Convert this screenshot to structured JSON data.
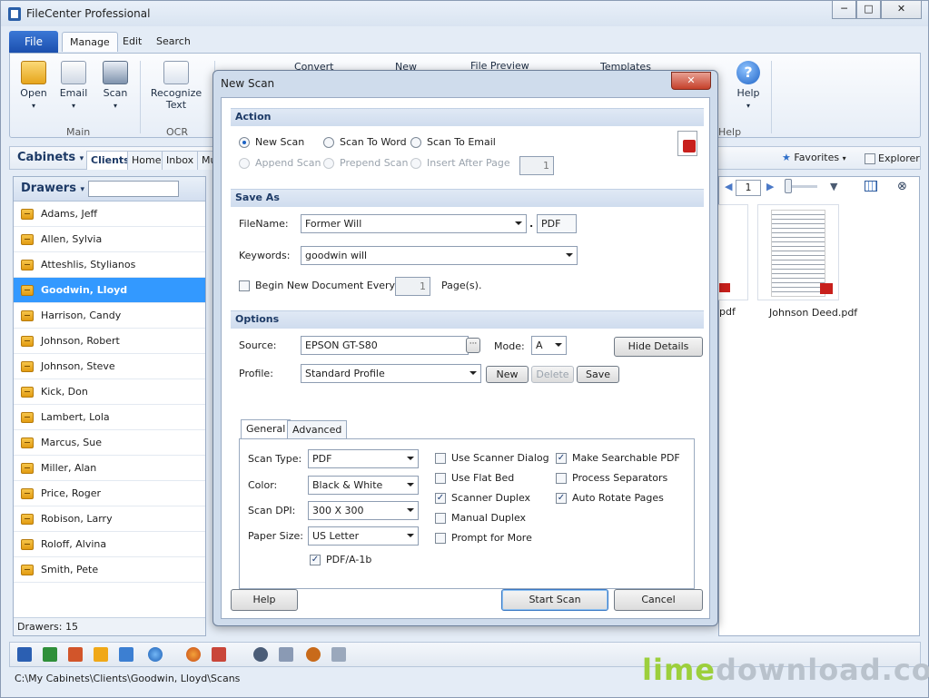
{
  "window": {
    "title": "FileCenter Professional",
    "min": "─",
    "max": "□",
    "close": "✕"
  },
  "ribbon": {
    "file_tab": "File",
    "tabs": [
      "Manage",
      "Edit",
      "Search"
    ],
    "buttons": {
      "open": "Open",
      "email": "Email",
      "scan": "Scan",
      "recognize": "Recognize",
      "recognize2": "Text",
      "convert": "Convert",
      "new": "New",
      "file_preview": "File Preview",
      "templates": "Templates",
      "help": "Help"
    },
    "groups": {
      "main": "Main",
      "ocr": "OCR",
      "help": "Help"
    }
  },
  "cabinets": {
    "label": "Cabinets",
    "tabs": [
      "Clients",
      "Home",
      "Inbox",
      "Mu"
    ],
    "favorites": "Favorites",
    "explorer": "Explorer",
    "page": "1"
  },
  "drawers": {
    "label": "Drawers",
    "items": [
      "Adams, Jeff",
      "Allen, Sylvia",
      "Atteshlis, Stylianos",
      "Goodwin, Lloyd",
      "Harrison, Candy",
      "Johnson, Robert",
      "Johnson, Steve",
      "Kick, Don",
      "Lambert, Lola",
      "Marcus, Sue",
      "Miller, Alan",
      "Price, Roger",
      "Robison, Larry",
      "Roloff, Alvina",
      "Smith, Pete"
    ],
    "status": "Drawers: 15"
  },
  "files": {
    "partial": "pdf",
    "name": "Johnson Deed.pdf"
  },
  "statusbar": {
    "path": "C:\\My Cabinets\\Clients\\Goodwin, Lloyd\\Scans"
  },
  "watermark": {
    "a": "lime",
    "b": "download.com"
  },
  "dialog": {
    "title": "New Scan",
    "close": "✕",
    "action": {
      "header": "Action",
      "new_scan": "New Scan",
      "scan_to_word": "Scan To Word",
      "scan_to_email": "Scan To Email",
      "append_scan": "Append Scan",
      "prepend_scan": "Prepend Scan",
      "insert_after_page": "Insert After Page",
      "page_value": "1"
    },
    "save_as": {
      "header": "Save As",
      "filename_label": "FileName:",
      "filename_value": "Former Will",
      "dot": ".",
      "extension": "PDF",
      "keywords_label": "Keywords:",
      "keywords_value": "goodwin will",
      "begin_new": "Begin New Document Every",
      "pages_value": "1",
      "pages_label": "Page(s)."
    },
    "options": {
      "header": "Options",
      "source_label": "Source:",
      "source_value": "EPSON GT-S80",
      "browse": "···",
      "mode_label": "Mode:",
      "mode_value": "A",
      "hide_details": "Hide Details",
      "profile_label": "Profile:",
      "profile_value": "Standard Profile",
      "new": "New",
      "delete": "Delete",
      "save": "Save"
    },
    "tabs": {
      "general": "General",
      "advanced": "Advanced"
    },
    "general": {
      "scan_type_label": "Scan Type:",
      "scan_type": "PDF",
      "color_label": "Color:",
      "color": "Black & White",
      "dpi_label": "Scan DPI:",
      "dpi": "300 X 300",
      "paper_label": "Paper Size:",
      "paper": "US Letter",
      "pdfa": "PDF/A-1b",
      "use_scanner_dialog": "Use Scanner Dialog",
      "use_flat_bed": "Use Flat Bed",
      "scanner_duplex": "Scanner Duplex",
      "manual_duplex": "Manual Duplex",
      "prompt_for_more": "Prompt for More",
      "make_searchable": "Make Searchable PDF",
      "process_separators": "Process Separators",
      "auto_rotate": "Auto Rotate Pages"
    },
    "footer": {
      "help": "Help",
      "start": "Start Scan",
      "cancel": "Cancel"
    }
  },
  "colors": {
    "accent": "#3399ff",
    "ribbon_blue": "#1b4fae",
    "pdf_red": "#c8201c"
  }
}
